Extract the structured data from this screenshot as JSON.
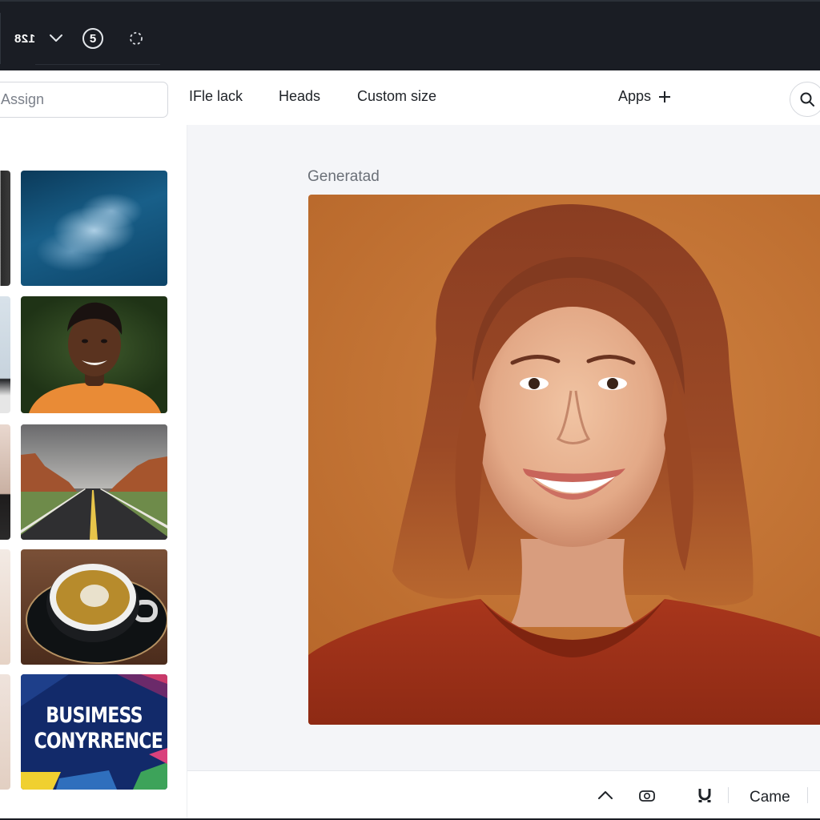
{
  "topbar": {
    "counter": "128",
    "badge": "5"
  },
  "toolbar": {
    "assign_placeholder": "Assign",
    "menu": [
      "IFle lack",
      "Heads",
      "Custom size",
      "Apps"
    ],
    "search_icon": "search-icon"
  },
  "left_panel": {
    "thumbnails": [
      {
        "subject": "blue smoke abstract"
      },
      {
        "subject": "smiling young man portrait"
      },
      {
        "subject": "desert road"
      },
      {
        "subject": "coffee cup"
      },
      {
        "subject": "conference poster",
        "lines": [
          "BUSIMESS",
          "CONYRRENCE"
        ]
      }
    ]
  },
  "canvas": {
    "label": "Generatad"
  },
  "bottombar": {
    "action_label": "Came"
  },
  "colors": {
    "topbar_bg": "#1a1d24",
    "canvas_bg": "#f4f5f8",
    "portrait_bg": "#c57434"
  }
}
